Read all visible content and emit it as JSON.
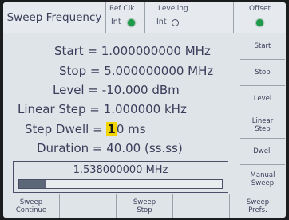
{
  "header": {
    "title": "Sweep Frequency",
    "ref_clk": {
      "label": "Ref Clk",
      "value": "Int",
      "led": "on"
    },
    "leveling": {
      "label": "Leveling",
      "value": "Int",
      "led": "off"
    },
    "offset": {
      "label": "Offset",
      "led": "on"
    }
  },
  "params": {
    "start": "Start = 1.000000000 MHz",
    "stop": "Stop = 5.000000000 MHz",
    "level": "Level = -10.000 dBm",
    "linear_step": "Linear Step = 1.000000 kHz",
    "step_dwell_prefix": "Step Dwell = ",
    "step_dwell_cursor_digit": "1",
    "step_dwell_rest": "0 ms",
    "duration": "Duration = 40.00 (ss.ss)"
  },
  "current_frequency": "1.538000000 MHz",
  "sweep_progress": 0.135,
  "softkeys_right": [
    {
      "line1": "Start",
      "line2": ""
    },
    {
      "line1": "Stop",
      "line2": ""
    },
    {
      "line1": "Level",
      "line2": ""
    },
    {
      "line1": "Linear",
      "line2": "Step"
    },
    {
      "line1": "Dwell",
      "line2": ""
    },
    {
      "line1": "Manual",
      "line2": "Sweep"
    }
  ],
  "softkeys_bottom": [
    {
      "line1": "Sweep",
      "line2": "Continue"
    },
    {
      "line1": "",
      "line2": ""
    },
    {
      "line1": "Sweep",
      "line2": "Stop"
    },
    {
      "line1": "",
      "line2": ""
    },
    {
      "line1": "Sweep",
      "line2": "Prefs."
    }
  ],
  "colors": {
    "led_green": "#1f9a4a",
    "cursor_highlight": "#f2d400",
    "text": "#3a3e5a",
    "screen_bg": "#dfe4e8"
  }
}
